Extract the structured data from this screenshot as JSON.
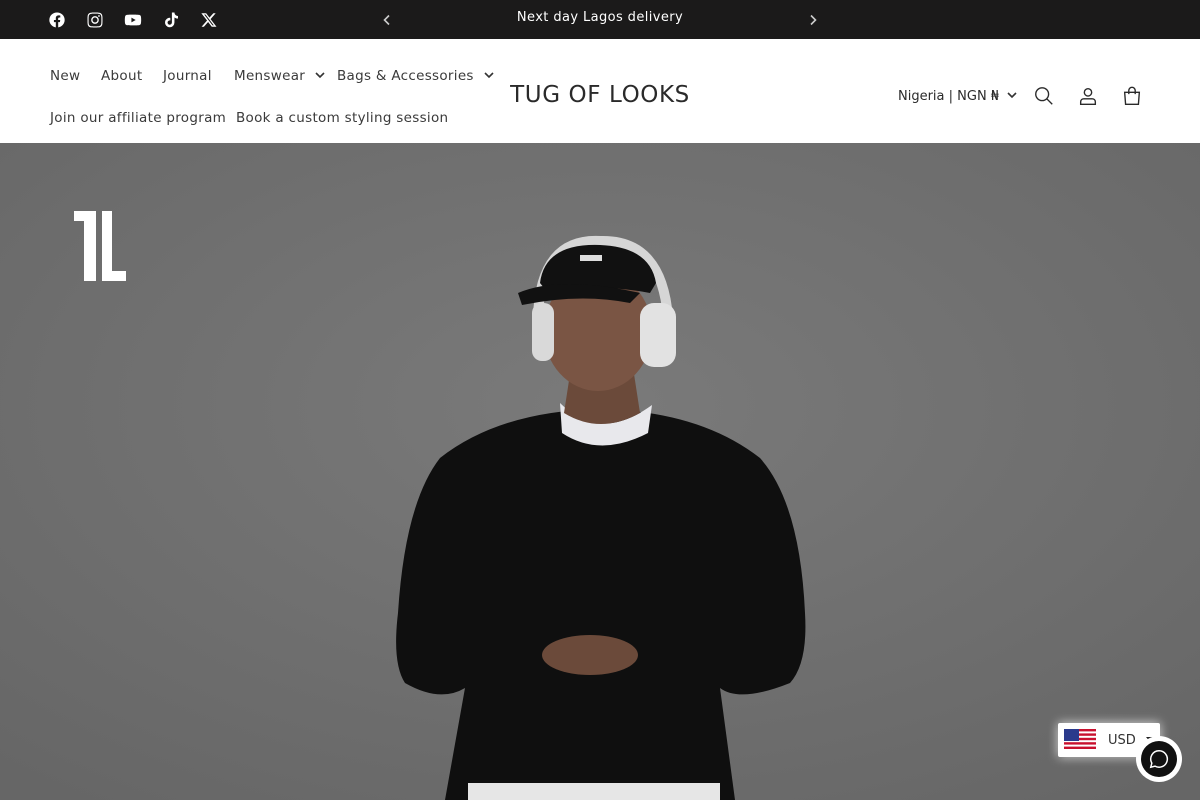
{
  "announcement": {
    "text": "Next day Lagos delivery",
    "prev_icon": "chevron-left-icon",
    "next_icon": "chevron-right-icon"
  },
  "social_links": [
    "facebook-icon",
    "instagram-icon",
    "youtube-icon",
    "tiktok-icon",
    "x-icon"
  ],
  "nav": {
    "new": "New",
    "about": "About",
    "journal": "Journal",
    "menswear": "Menswear",
    "bags": "Bags & Accessories",
    "affiliate": "Join our affiliate program",
    "styling": "Book a custom styling session"
  },
  "brand": "TUG OF LOOKS",
  "localization": {
    "country": "Nigeria | NGN ₦"
  },
  "header_icons": [
    "search-icon",
    "account-icon",
    "cart-icon"
  ],
  "currency_widget": {
    "code": "USD",
    "flag": "us-flag-icon"
  },
  "colors": {
    "announcement_bg": "#1b1a1a",
    "header_bg": "#ffffff",
    "hero_overlay": "#6e6e6e"
  }
}
